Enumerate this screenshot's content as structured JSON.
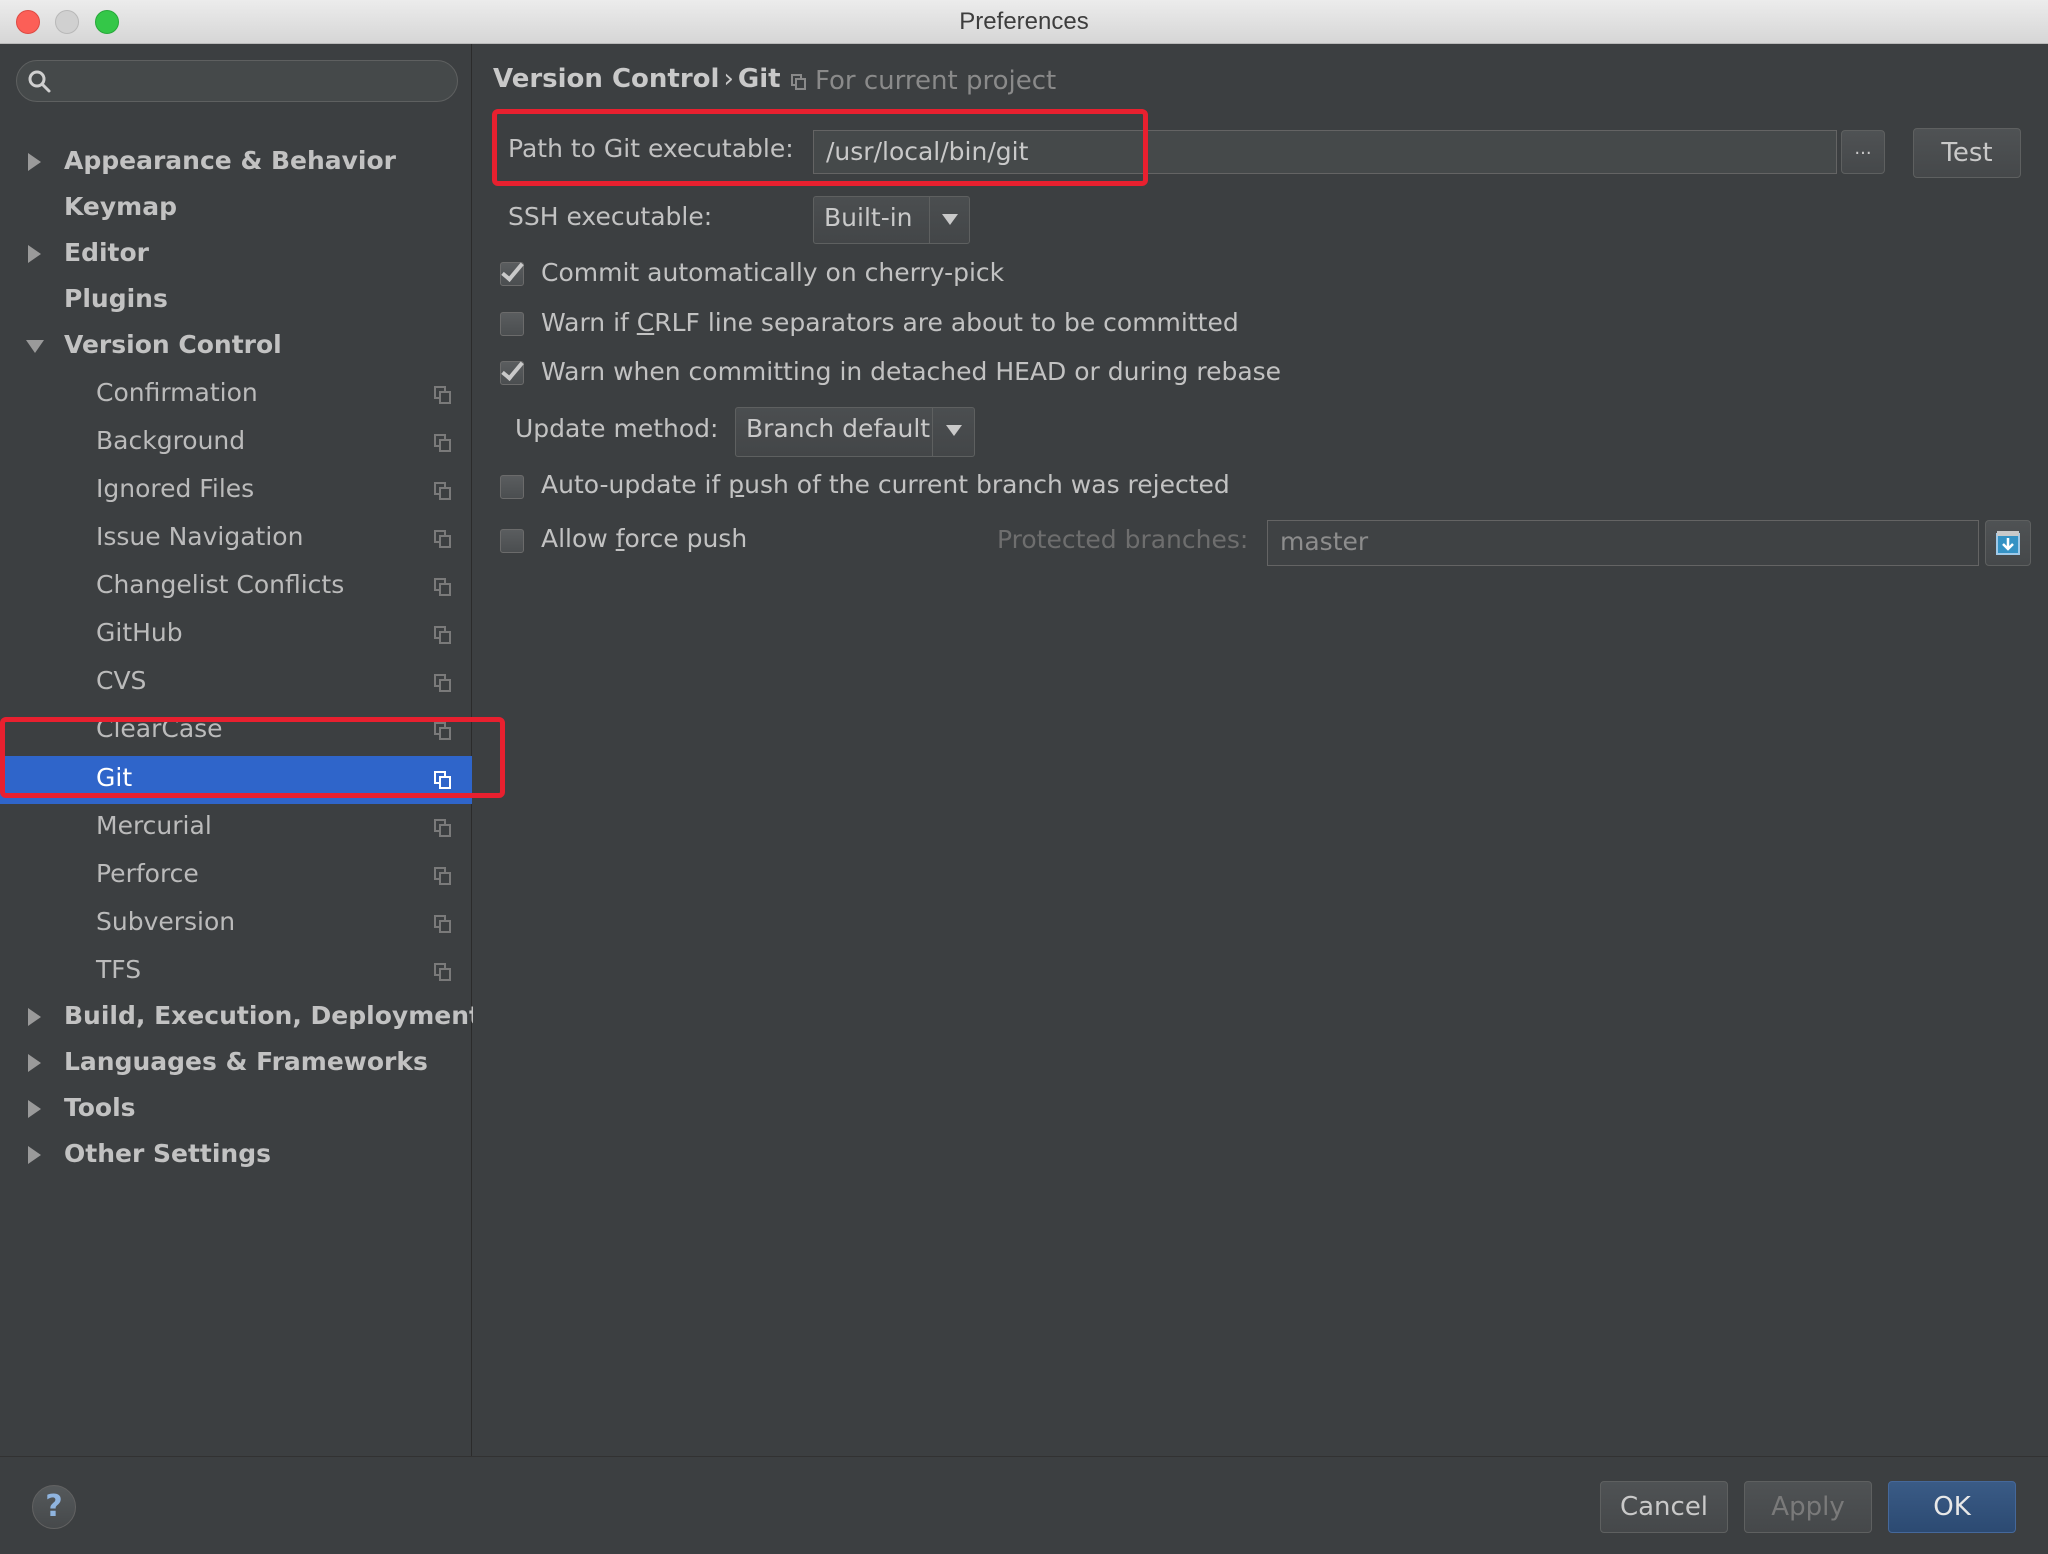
{
  "window": {
    "title": "Preferences"
  },
  "search": {
    "placeholder": ""
  },
  "sidebar": {
    "items": [
      {
        "label": "Appearance & Behavior",
        "expandable": true,
        "expanded": false,
        "level": 0
      },
      {
        "label": "Keymap",
        "expandable": false,
        "level": 0
      },
      {
        "label": "Editor",
        "expandable": true,
        "expanded": false,
        "level": 0
      },
      {
        "label": "Plugins",
        "expandable": false,
        "level": 0
      },
      {
        "label": "Version Control",
        "expandable": true,
        "expanded": true,
        "level": 0
      },
      {
        "label": "Confirmation",
        "level": 1
      },
      {
        "label": "Background",
        "level": 1
      },
      {
        "label": "Ignored Files",
        "level": 1
      },
      {
        "label": "Issue Navigation",
        "level": 1
      },
      {
        "label": "Changelist Conflicts",
        "level": 1
      },
      {
        "label": "GitHub",
        "level": 1
      },
      {
        "label": "CVS",
        "level": 1
      },
      {
        "label": "ClearCase",
        "level": 1
      },
      {
        "label": "Git",
        "level": 1,
        "selected": true
      },
      {
        "label": "Mercurial",
        "level": 1
      },
      {
        "label": "Perforce",
        "level": 1
      },
      {
        "label": "Subversion",
        "level": 1
      },
      {
        "label": "TFS",
        "level": 1
      },
      {
        "label": "Build, Execution, Deployment",
        "expandable": true,
        "expanded": false,
        "level": 0
      },
      {
        "label": "Languages & Frameworks",
        "expandable": true,
        "expanded": false,
        "level": 0
      },
      {
        "label": "Tools",
        "expandable": true,
        "expanded": false,
        "level": 0
      },
      {
        "label": "Other Settings",
        "expandable": true,
        "expanded": false,
        "level": 0
      }
    ]
  },
  "main": {
    "breadcrumb": {
      "parent": "Version Control",
      "separator": "›",
      "current": "Git",
      "scope": "For current project"
    },
    "git_path": {
      "label": "Path to Git executable:",
      "value": "/usr/local/bin/git",
      "browse_label": "...",
      "test_label": "Test"
    },
    "ssh": {
      "label": "SSH executable:",
      "value": "Built-in"
    },
    "checkboxes": {
      "cherry_pick": {
        "label": "Commit automatically on cherry-pick",
        "checked": true
      },
      "crlf": {
        "prefix": "Warn if ",
        "mnemonic": "C",
        "suffix": "RLF line separators are about to be committed",
        "checked": false
      },
      "detached": {
        "label": "Warn when committing in detached HEAD or during rebase",
        "checked": true
      },
      "auto_update": {
        "prefix": "Auto-update if ",
        "mnemonic": "p",
        "suffix": "ush of the current branch was rejected",
        "checked": false
      },
      "force_push": {
        "prefix": "Allow ",
        "mnemonic": "f",
        "suffix": "orce push",
        "checked": false
      }
    },
    "update_method": {
      "label": "Update method:",
      "value": "Branch default"
    },
    "protected_branches": {
      "label": "Protected branches:",
      "value": "master"
    }
  },
  "footer": {
    "help_label": "?",
    "cancel_label": "Cancel",
    "apply_label": "Apply",
    "ok_label": "OK"
  },
  "colors": {
    "selection": "#2f65ca",
    "highlight_frame": "#e8202f",
    "background": "#3c3f41"
  }
}
